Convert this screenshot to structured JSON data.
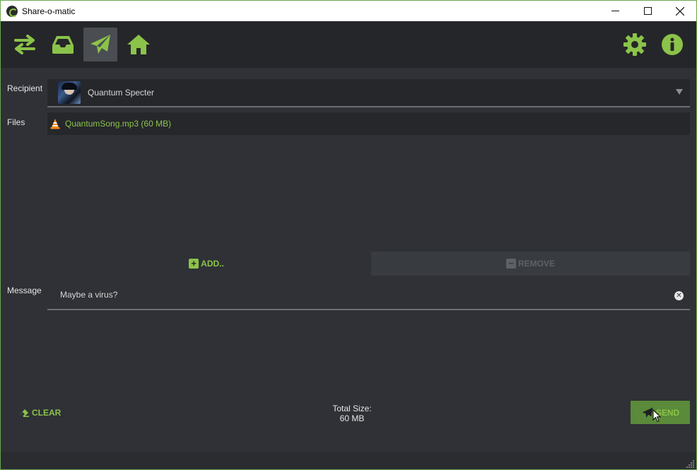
{
  "window": {
    "title": "Share-o-matic"
  },
  "toolbar": {
    "buttons": [
      {
        "name": "transfers",
        "icon": "swap-arrows-icon"
      },
      {
        "name": "inbox",
        "icon": "inbox-tray-icon"
      },
      {
        "name": "send",
        "icon": "paper-plane-icon",
        "active": true
      },
      {
        "name": "home",
        "icon": "home-icon"
      },
      {
        "name": "settings",
        "icon": "gear-icon"
      },
      {
        "name": "info",
        "icon": "info-icon"
      }
    ]
  },
  "form": {
    "recipient_label": "Recipient",
    "recipient_name": "Quantum Specter",
    "files_label": "Files",
    "files": [
      {
        "name": "QuantumSong.mp3 (60 MB)",
        "icon": "traffic-cone-icon"
      }
    ],
    "add_label": "ADD..",
    "remove_label": "REMOVE",
    "message_label": "Message",
    "message_value": "Maybe a virus?"
  },
  "footer": {
    "clear_label": "CLEAR",
    "total_size_label": "Total Size:",
    "total_size_value": "60 MB",
    "send_label": "SEND"
  },
  "colors": {
    "accent": "#8bc34a",
    "background": "#2f3136",
    "toolbar": "#252629",
    "input_bg": "#26272b",
    "send_bg": "#5a8a3a"
  }
}
